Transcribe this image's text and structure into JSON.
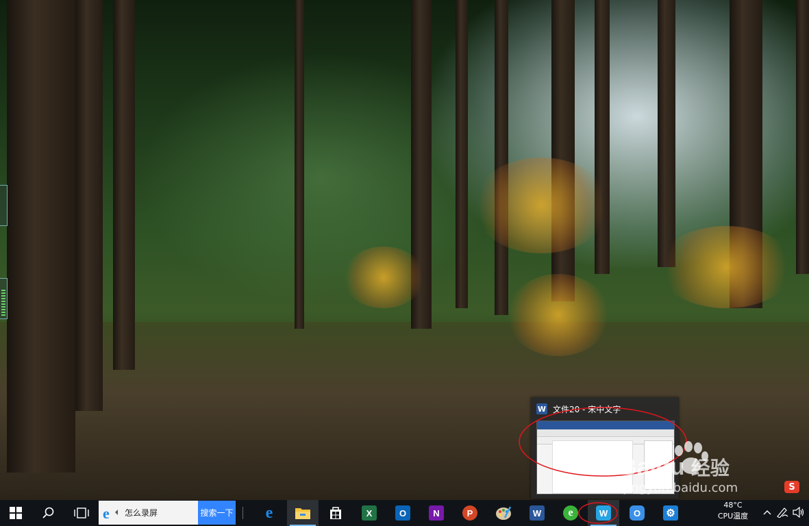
{
  "preview": {
    "app_icon_letter": "W",
    "title": "文件20 - 宋中文字"
  },
  "taskbar": {
    "search_placeholder": "怎么录屏",
    "search_button_label": "搜索一下",
    "apps": [
      {
        "name": "edge",
        "letter": "e",
        "color": "#1e88e5"
      },
      {
        "name": "file-explorer",
        "letter": "",
        "color": "#f3c23c"
      },
      {
        "name": "store",
        "letter": "",
        "color": "#ffffff"
      },
      {
        "name": "excel",
        "letter": "X",
        "color": "#217346"
      },
      {
        "name": "outlook",
        "letter": "O",
        "color": "#0a64b8"
      },
      {
        "name": "onenote",
        "letter": "N",
        "color": "#7719aa"
      },
      {
        "name": "powerpoint",
        "letter": "P",
        "color": "#d24726"
      },
      {
        "name": "paint",
        "letter": "",
        "color": "#3aa0e8"
      },
      {
        "name": "word",
        "letter": "W",
        "color": "#2b579a"
      },
      {
        "name": "browser-360",
        "letter": "e",
        "color": "#3bb33b"
      },
      {
        "name": "wps-writer",
        "letter": "W",
        "color": "#27a5e2"
      },
      {
        "name": "app-o",
        "letter": "O",
        "color": "#3a8fe8"
      },
      {
        "name": "settings",
        "letter": "⚙",
        "color": "#1c7fd6"
      }
    ],
    "tray": {
      "cpu_temp_value": "48°C",
      "cpu_temp_label": "CPU温度"
    }
  },
  "watermark": {
    "brand": "Baidu",
    "brand_suffix": "经验",
    "url": "jingyan.baidu.com"
  }
}
